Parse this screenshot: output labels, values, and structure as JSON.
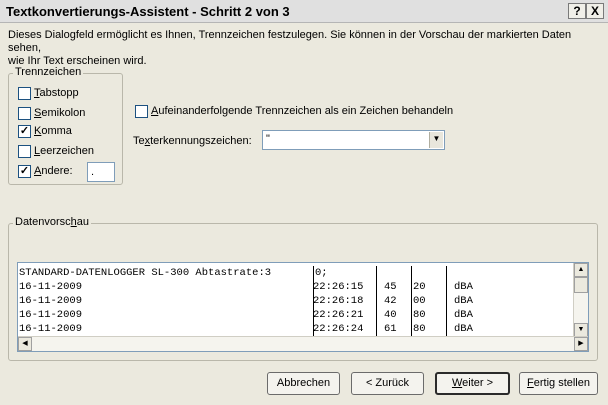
{
  "window": {
    "title": "Textkonvertierungs-Assistent - Schritt 2 von 3",
    "help_label": "?",
    "close_label": "X"
  },
  "description": {
    "line1": "Dieses Dialogfeld ermöglicht es Ihnen, Trennzeichen festzulegen. Sie können in der Vorschau der markierten Daten sehen,",
    "line2": "wie Ihr Text erscheinen wird."
  },
  "delimiters": {
    "group_label": "Trennzeichen",
    "items": [
      {
        "label_mn": "T",
        "label_rest": "abstopp",
        "checked": false
      },
      {
        "label_mn": "S",
        "label_rest": "emikolon",
        "checked": false
      },
      {
        "label_mn": "K",
        "label_rest": "omma",
        "checked": true
      },
      {
        "label_mn": "L",
        "label_rest": "eerzeichen",
        "checked": false
      },
      {
        "label_mn": "A",
        "label_rest": "ndere:",
        "checked": true
      }
    ],
    "other_value": "."
  },
  "consecutive": {
    "label_mn": "A",
    "label_rest": "ufeinanderfolgende Trennzeichen als ein Zeichen behandeln",
    "checked": false
  },
  "text_qualifier": {
    "label_pre": "Te",
    "label_mn": "x",
    "label_post": "terkennungszeichen:",
    "value": "\""
  },
  "preview": {
    "group_label_pre": "Datenvorsc",
    "group_label_mn": "h",
    "group_label_post": "au",
    "header_line": "STANDARD-DATENLOGGER SL-300 Abtastrate:3",
    "header_extra": "0;",
    "rows": [
      {
        "c1": "16-11-2009",
        "c2": "22:26:15",
        "c3": "45",
        "c4": "20",
        "c5": "dBA"
      },
      {
        "c1": "16-11-2009",
        "c2": "22:26:18",
        "c3": "42",
        "c4": "00",
        "c5": "dBA"
      },
      {
        "c1": "16-11-2009",
        "c2": "22:26:21",
        "c3": "40",
        "c4": "80",
        "c5": "dBA"
      },
      {
        "c1": "16-11-2009",
        "c2": "22:26:24",
        "c3": "61",
        "c4": "80",
        "c5": "dBA"
      }
    ]
  },
  "buttons": {
    "cancel": "Abbrechen",
    "back": "< Zurück",
    "next_mn": "W",
    "next_rest": "eiter >",
    "finish_mn": "F",
    "finish_rest": "ertig stellen"
  }
}
